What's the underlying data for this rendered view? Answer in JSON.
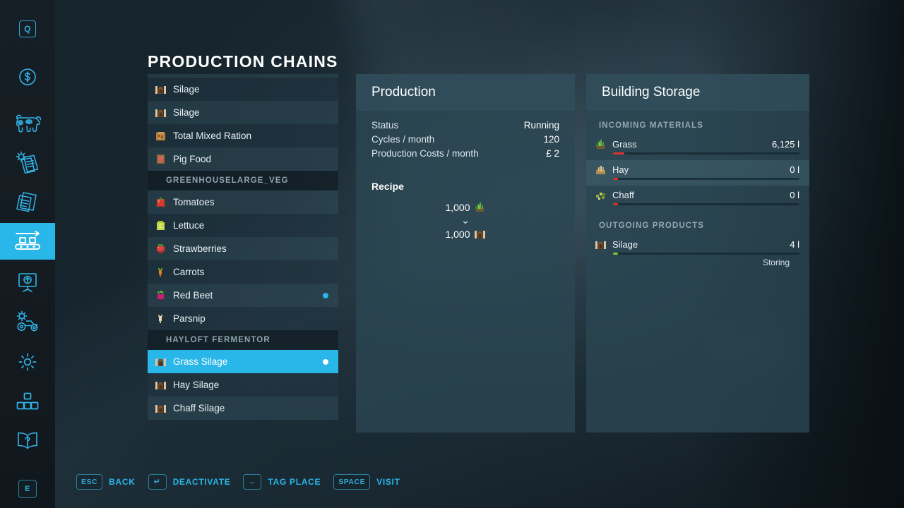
{
  "page": {
    "title": "PRODUCTION CHAINS"
  },
  "sidebar": {
    "items": [
      {
        "name": "quest-icon",
        "label": "Q"
      },
      {
        "name": "finances-icon",
        "label": "$"
      },
      {
        "name": "animals-icon",
        "label": "Animals"
      },
      {
        "name": "contracts-icon",
        "label": "Contracts"
      },
      {
        "name": "documents-icon",
        "label": "Documents"
      },
      {
        "name": "production-icon",
        "label": "Production Chains"
      },
      {
        "name": "map-overview-icon",
        "label": "Map Overview"
      },
      {
        "name": "vehicle-config-icon",
        "label": "Vehicle Configuration"
      },
      {
        "name": "settings-icon",
        "label": "Settings"
      },
      {
        "name": "construction-icon",
        "label": "Construction"
      },
      {
        "name": "help-icon",
        "label": "Help"
      }
    ],
    "active_index": 5,
    "bottom_key": "E"
  },
  "list": {
    "rows": [
      {
        "type": "item",
        "icon": "silage",
        "label": "Silage",
        "dot": false,
        "selected": false,
        "clipped": true
      },
      {
        "type": "item",
        "icon": "silage",
        "label": "Silage",
        "dot": false,
        "selected": false
      },
      {
        "type": "item",
        "icon": "silage",
        "label": "Silage",
        "dot": false,
        "selected": false
      },
      {
        "type": "item",
        "icon": "tmr",
        "label": "Total Mixed Ration",
        "dot": false,
        "selected": false
      },
      {
        "type": "item",
        "icon": "pigfood",
        "label": "Pig Food",
        "dot": false,
        "selected": false
      },
      {
        "type": "header",
        "label": "GREENHOUSELARGE_VEG"
      },
      {
        "type": "item",
        "icon": "tomato",
        "label": "Tomatoes",
        "dot": false,
        "selected": false
      },
      {
        "type": "item",
        "icon": "lettuce",
        "label": "Lettuce",
        "dot": false,
        "selected": false
      },
      {
        "type": "item",
        "icon": "strawberry",
        "label": "Strawberries",
        "dot": false,
        "selected": false
      },
      {
        "type": "item",
        "icon": "carrot",
        "label": "Carrots",
        "dot": false,
        "selected": false
      },
      {
        "type": "item",
        "icon": "redbeet",
        "label": "Red Beet",
        "dot": true,
        "selected": false
      },
      {
        "type": "item",
        "icon": "parsnip",
        "label": "Parsnip",
        "dot": false,
        "selected": false
      },
      {
        "type": "header",
        "label": "HAYLOFT FERMENTOR"
      },
      {
        "type": "item",
        "icon": "silage",
        "label": "Grass Silage",
        "dot": true,
        "selected": true
      },
      {
        "type": "item",
        "icon": "silage",
        "label": "Hay Silage",
        "dot": false,
        "selected": false
      },
      {
        "type": "item",
        "icon": "silage",
        "label": "Chaff Silage",
        "dot": false,
        "selected": false
      }
    ],
    "scroll": {
      "thumb_top_pct": 46,
      "thumb_height_pct": 54
    }
  },
  "production": {
    "title": "Production",
    "stats": [
      {
        "label": "Status",
        "value": "Running"
      },
      {
        "label": "Cycles / month",
        "value": "120"
      },
      {
        "label": "Production Costs / month",
        "value": "£ 2"
      }
    ],
    "recipe_title": "Recipe",
    "recipe": {
      "input": {
        "amount": "1,000",
        "icon": "grass"
      },
      "arrow": "chevron-down",
      "output": {
        "amount": "1,000",
        "icon": "silage"
      }
    }
  },
  "storage": {
    "title": "Building Storage",
    "incoming_title": "INCOMING MATERIALS",
    "incoming": [
      {
        "icon": "grass",
        "label": "Grass",
        "amount": "6,125 l",
        "fill_pct": 6,
        "fill_color": "#d8332e"
      },
      {
        "icon": "hay",
        "label": "Hay",
        "amount": "0 l",
        "fill_pct": 2.5,
        "fill_color": "#d8332e"
      },
      {
        "icon": "chaff",
        "label": "Chaff",
        "amount": "0 l",
        "fill_pct": 2.5,
        "fill_color": "#d8332e"
      }
    ],
    "outgoing_title": "OUTGOING PRODUCTS",
    "outgoing": [
      {
        "icon": "silage",
        "label": "Silage",
        "amount": "4 l",
        "fill_pct": 2.5,
        "fill_color": "#7ac943",
        "note": "Storing"
      }
    ]
  },
  "footer": {
    "hints": [
      {
        "key": "ESC",
        "label": "BACK",
        "glyph": "text"
      },
      {
        "key": "↵",
        "label": "DEACTIVATE",
        "glyph": "enter"
      },
      {
        "key": "↔",
        "label": "TAG PLACE",
        "glyph": "leftright"
      },
      {
        "key": "SPACE",
        "label": "VISIT",
        "glyph": "text"
      }
    ]
  },
  "colors": {
    "accent": "#29b6e8",
    "panel": "#2b4653",
    "red": "#d8332e",
    "green": "#7ac943"
  }
}
